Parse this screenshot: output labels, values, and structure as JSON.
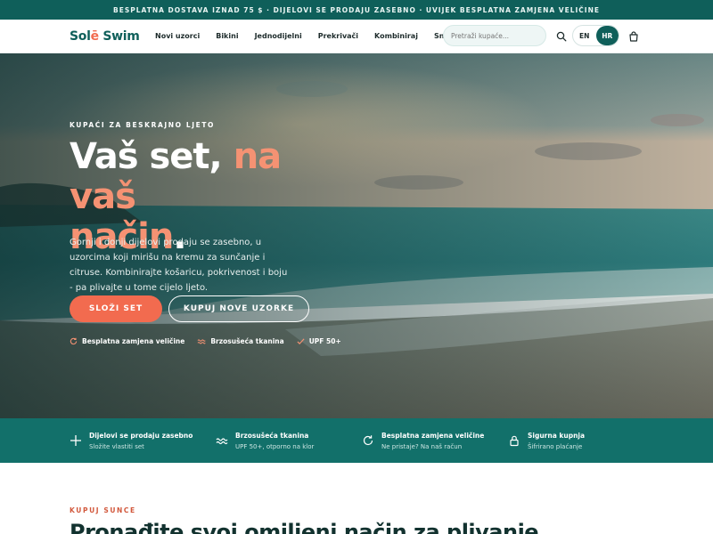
{
  "announcement": "BESPLATNA DOSTAVA IZNAD 75 $ · DIJELOVI SE PRODAJU ZASEBNO · UVIJEK BESPLATNA ZAMJENA VELIČINE",
  "header": {
    "logo_main": "Sol",
    "logo_accent": "ē",
    "logo_rest": " Swim",
    "nav": [
      "Novi uzorci",
      "Bikini",
      "Jednodijelni",
      "Prekrivači",
      "Kombiniraj",
      "Sniženje"
    ],
    "search_placeholder": "Pretraži kupaće...",
    "lang": [
      "EN",
      "HR"
    ],
    "lang_active": "HR"
  },
  "hero": {
    "eyebrow": "KUPAĆI ZA BESKRAJNO LJETO",
    "title_1": "Vaš set, ",
    "title_hl_1": "na vaš",
    "title_hl_2": "način",
    "title_end": ".",
    "description": "Gornji i donji dijelovi prodaju se zasebno, u uzorcima koji mirišu na kremu za sunčanje i citruse. Kombinirajte košaricu, pokrivenost i boju - pa plivajte u tome cijelo ljeto.",
    "cta_primary": "SLOŽI SET",
    "cta_secondary": "KUPUJ NOVE UZORKE",
    "perks": [
      "Besplatna zamjena veličine",
      "Brzosušeća tkanina",
      "UPF 50+"
    ]
  },
  "features": [
    {
      "title": "Dijelovi se prodaju zasebno",
      "subtitle": "Složite vlastiti set",
      "icon": "plus-icon"
    },
    {
      "title": "Brzosušeća tkanina",
      "subtitle": "UPF 50+, otporno na klor",
      "icon": "wave-icon"
    },
    {
      "title": "Besplatna zamjena veličine",
      "subtitle": "Ne pristaje? Na naš račun",
      "icon": "refresh-icon"
    },
    {
      "title": "Sigurna kupnja",
      "subtitle": "Šifrirano plaćanje",
      "icon": "lock-icon"
    }
  ],
  "section": {
    "eyebrow": "KUPUJ SUNCE",
    "title": "Pronađite svoj omiljeni način za plivanje"
  },
  "colors": {
    "teal": "#0f5f5a",
    "coral": "#f26b4f",
    "peach": "#f59273"
  }
}
